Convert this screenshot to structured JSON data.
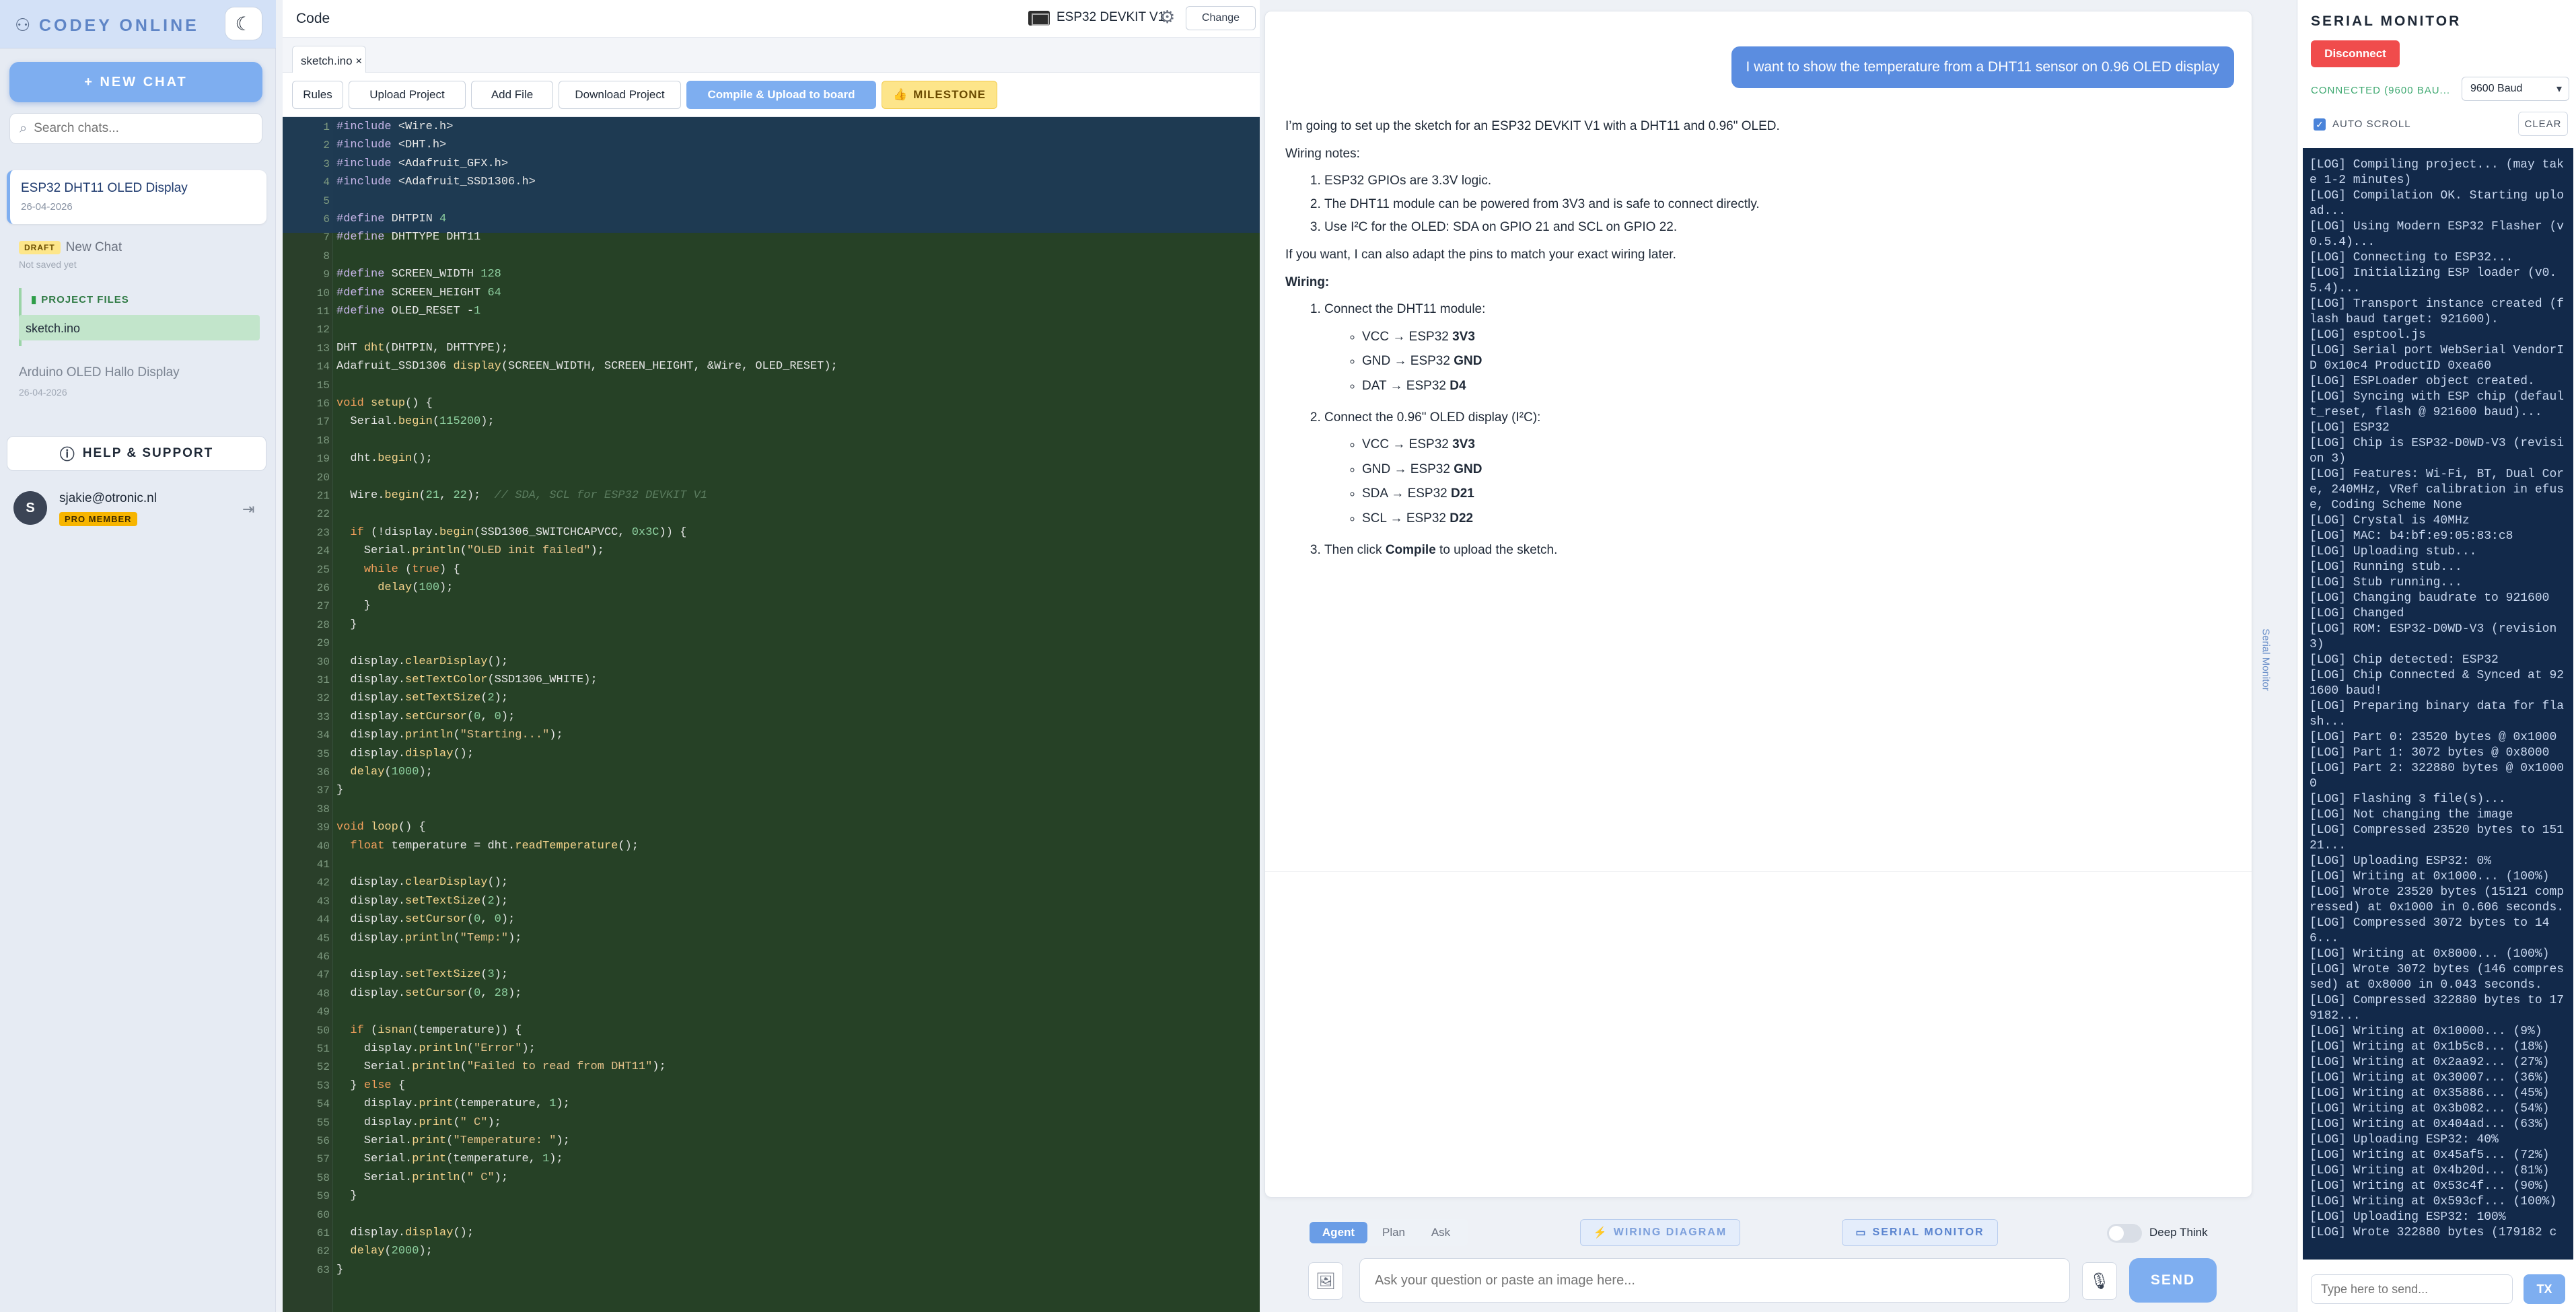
{
  "sidebar": {
    "brand": "CODEY ONLINE",
    "new_chat": "+ NEW CHAT",
    "search_placeholder": "Search chats...",
    "chats": [
      {
        "title": "ESP32 DHT11 OLED Display",
        "date": "26-04-2026"
      },
      {
        "badge": "DRAFT",
        "title": "New Chat",
        "date": "Not saved yet"
      },
      {
        "title": "Arduino OLED Hallo Display",
        "date": "26-04-2026"
      }
    ],
    "project_files_label": "PROJECT FILES",
    "project_file": "sketch.ino",
    "help": "HELP & SUPPORT",
    "user": {
      "initial": "S",
      "email": "sjakie@otronic.nl",
      "plan": "PRO MEMBER"
    }
  },
  "code": {
    "title": "Code",
    "board": "ESP32 DEVKIT V1",
    "change": "Change",
    "tab": "sketch.ino ×",
    "toolbar": {
      "rules": "Rules",
      "upload": "Upload Project",
      "add": "Add File",
      "download": "Download Project",
      "compile": "Compile & Upload to board",
      "milestone": "MILESTONE"
    },
    "lines": [
      "#include <Wire.h>",
      "#include <DHT.h>",
      "#include <Adafruit_GFX.h>",
      "#include <Adafruit_SSD1306.h>",
      "",
      "#define DHTPIN 4",
      "#define DHTTYPE DHT11",
      "",
      "#define SCREEN_WIDTH 128",
      "#define SCREEN_HEIGHT 64",
      "#define OLED_RESET -1",
      "",
      "DHT dht(DHTPIN, DHTTYPE);",
      "Adafruit_SSD1306 display(SCREEN_WIDTH, SCREEN_HEIGHT, &Wire, OLED_RESET);",
      "",
      "void setup() {",
      "  Serial.begin(115200);",
      "",
      "  dht.begin();",
      "",
      "  Wire.begin(21, 22);  // SDA, SCL for ESP32 DEVKIT V1",
      "",
      "  if (!display.begin(SSD1306_SWITCHCAPVCC, 0x3C)) {",
      "    Serial.println(\"OLED init failed\");",
      "    while (true) {",
      "      delay(100);",
      "    }",
      "  }",
      "",
      "  display.clearDisplay();",
      "  display.setTextColor(SSD1306_WHITE);",
      "  display.setTextSize(2);",
      "  display.setCursor(0, 0);",
      "  display.println(\"Starting...\");",
      "  display.display();",
      "  delay(1000);",
      "}",
      "",
      "void loop() {",
      "  float temperature = dht.readTemperature();",
      "",
      "  display.clearDisplay();",
      "  display.setTextSize(2);",
      "  display.setCursor(0, 0);",
      "  display.println(\"Temp:\");",
      "",
      "  display.setTextSize(3);",
      "  display.setCursor(0, 28);",
      "",
      "  if (isnan(temperature)) {",
      "    display.println(\"Error\");",
      "    Serial.println(\"Failed to read from DHT11\");",
      "  } else {",
      "    display.print(temperature, 1);",
      "    display.print(\" C\");",
      "    Serial.print(\"Temperature: \");",
      "    Serial.print(temperature, 1);",
      "    Serial.println(\" C\");",
      "  }",
      "",
      "  display.display();",
      "  delay(2000);",
      "}"
    ]
  },
  "chat": {
    "user_message": "I want to show the temperature from a DHT11 sensor on 0.96 OLED display",
    "intro": "I’m going to set up the sketch for an ESP32 DEVKIT V1 with a DHT11 and 0.96\" OLED.",
    "wiring_notes_label": "Wiring notes:",
    "notes": [
      "ESP32 GPIOs are 3.3V logic.",
      "The DHT11 module can be powered from 3V3 and is safe to connect directly.",
      "Use I²C for the OLED: SDA on GPIO 21 and SCL on GPIO 22."
    ],
    "adapt": "If you want, I can also adapt the pins to match your exact wiring later.",
    "wiring_label": "Wiring:",
    "step1": "Connect the DHT11 module:",
    "step1_items": [
      {
        "pin": "VCC → ESP32 ",
        "target": "3V3"
      },
      {
        "pin": "GND → ESP32 ",
        "target": "GND"
      },
      {
        "pin": "DAT → ESP32 ",
        "target": "D4"
      }
    ],
    "step2": "Connect the 0.96\" OLED display (I²C):",
    "step2_items": [
      {
        "pin": "VCC → ESP32 ",
        "target": "3V3"
      },
      {
        "pin": "GND → ESP32 ",
        "target": "GND"
      },
      {
        "pin": "SDA → ESP32 ",
        "target": "D21"
      },
      {
        "pin": "SCL → ESP32 ",
        "target": "D22"
      }
    ],
    "step3_pre": "Then click ",
    "step3_bold": "Compile",
    "step3_post": " to upload the sketch.",
    "modes": [
      "Agent",
      "Plan",
      "Ask"
    ],
    "wiring_btn": "WIRING DIAGRAM",
    "serial_btn": "SERIAL MONITOR",
    "deep_think": "Deep Think",
    "input_placeholder": "Ask your question or paste an image here...",
    "send": "SEND",
    "vertical_tab": "Serial Monitor"
  },
  "serial": {
    "title": "SERIAL MONITOR",
    "disconnect": "Disconnect",
    "status": "CONNECTED (9600 BAU...",
    "baud": "9600 Baud",
    "autoscroll": "AUTO SCROLL",
    "clear": "CLEAR",
    "log": [
      "[LOG] Compiling project... (may take 1-2 minutes)",
      "[LOG] Compilation OK. Starting upload...",
      "[LOG] Using Modern ESP32 Flasher (v0.5.4)...",
      "[LOG] Connecting to ESP32...",
      "[LOG] Initializing ESP loader (v0.5.4)...",
      "[LOG] Transport instance created (flash baud target: 921600).",
      "[LOG] esptool.js",
      "[LOG] Serial port WebSerial VendorID 0x10c4 ProductID 0xea60",
      "[LOG] ESPLoader object created.",
      "[LOG] Syncing with ESP chip (default_reset, flash @ 921600 baud)...",
      "[LOG] ESP32",
      "[LOG] Chip is ESP32-D0WD-V3 (revision 3)",
      "[LOG] Features: Wi-Fi, BT, Dual Core, 240MHz, VRef calibration in efuse, Coding Scheme None",
      "[LOG] Crystal is 40MHz",
      "[LOG] MAC: b4:bf:e9:05:83:c8",
      "[LOG] Uploading stub...",
      "[LOG] Running stub...",
      "[LOG] Stub running...",
      "[LOG] Changing baudrate to 921600",
      "[LOG] Changed",
      "[LOG] ROM: ESP32-D0WD-V3 (revision 3)",
      "[LOG] Chip detected: ESP32",
      "[LOG] Chip Connected & Synced at 921600 baud!",
      "[LOG] Preparing binary data for flash...",
      "[LOG] Part 0: 23520 bytes @ 0x1000",
      "[LOG] Part 1: 3072 bytes @ 0x8000",
      "[LOG] Part 2: 322880 bytes @ 0x10000",
      "[LOG] Flashing 3 file(s)...",
      "[LOG] Not changing the image",
      "[LOG] Compressed 23520 bytes to 15121...",
      "[LOG] Uploading ESP32: 0%",
      "[LOG] Writing at 0x1000... (100%)",
      "[LOG] Wrote 23520 bytes (15121 compressed) at 0x1000 in 0.606 seconds.",
      "[LOG] Compressed 3072 bytes to 146...",
      "[LOG] Writing at 0x8000... (100%)",
      "[LOG] Wrote 3072 bytes (146 compressed) at 0x8000 in 0.043 seconds.",
      "[LOG] Compressed 322880 bytes to 179182...",
      "[LOG] Writing at 0x10000... (9%)",
      "[LOG] Writing at 0x1b5c8... (18%)",
      "[LOG] Writing at 0x2aa92... (27%)",
      "[LOG] Writing at 0x30007... (36%)",
      "[LOG] Writing at 0x35886... (45%)",
      "[LOG] Writing at 0x3b082... (54%)",
      "[LOG] Writing at 0x404ad... (63%)",
      "[LOG] Uploading ESP32: 40%",
      "[LOG] Writing at 0x45af5... (72%)",
      "[LOG] Writing at 0x4b20d... (81%)",
      "[LOG] Writing at 0x53c4f... (90%)",
      "[LOG] Writing at 0x593cf... (100%)",
      "[LOG] Uploading ESP32: 100%",
      "[LOG] Wrote 322880 bytes (179182 c"
    ],
    "tx_placeholder": "Type here to send...",
    "tx": "TX"
  }
}
